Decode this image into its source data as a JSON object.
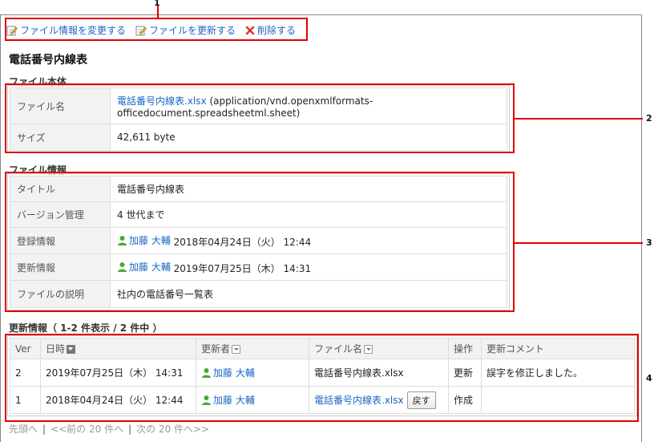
{
  "toolbar": {
    "edit_info": "ファイル情報を変更する",
    "update_file": "ファイルを更新する",
    "delete": "削除する"
  },
  "page_title": "電話番号内線表",
  "file_body": {
    "section_title": "ファイル本体",
    "name_label": "ファイル名",
    "file_name": "電話番号内線表.xlsx",
    "mime": "(application/vnd.openxmlformats-officedocument.spreadsheetml.sheet)",
    "size_label": "サイズ",
    "size": "42,611 byte"
  },
  "file_info": {
    "section_title": "ファイル情報",
    "title_label": "タイトル",
    "title": "電話番号内線表",
    "version_label": "バージョン管理",
    "version": "4 世代まで",
    "created_label": "登録情報",
    "created_user": "加藤 大輔",
    "created_at": "2018年04月24日（火） 12:44",
    "updated_label": "更新情報",
    "updated_user": "加藤 大輔",
    "updated_at": "2019年07月25日（木） 14:31",
    "desc_label": "ファイルの説明",
    "desc": "社内の電話番号一覧表"
  },
  "history": {
    "section_title": "更新情報（ 1-2 件表示 / 2 件中 ）",
    "headers": {
      "ver": "Ver",
      "date": "日時",
      "updater": "更新者",
      "filename": "ファイル名",
      "action": "操作",
      "comment": "更新コメント"
    },
    "rows": [
      {
        "ver": "2",
        "date": "2019年07月25日（木） 14:31",
        "updater": "加藤 大輔",
        "filename": "電話番号内線表.xlsx",
        "action": "更新",
        "comment": "誤字を修正しました。"
      },
      {
        "ver": "1",
        "date": "2018年04月24日（火） 12:44",
        "updater": "加藤 大輔",
        "filename": "電話番号内線表.xlsx",
        "back_label": "戻す",
        "action": "作成",
        "comment": ""
      }
    ]
  },
  "pager": {
    "first": "先頭へ",
    "prev": "<<前の 20 件へ",
    "next": "次の 20 件へ>>"
  },
  "callouts": [
    "1",
    "2",
    "3",
    "4"
  ],
  "colors": {
    "link": "#1a66c4",
    "callout": "#e00000",
    "header_bg": "#f2f2f2"
  },
  "icons": [
    "edit-icon",
    "edit-file-icon",
    "delete-x-icon",
    "user-icon",
    "sort-desc-icon",
    "sort-dropdown-icon"
  ]
}
